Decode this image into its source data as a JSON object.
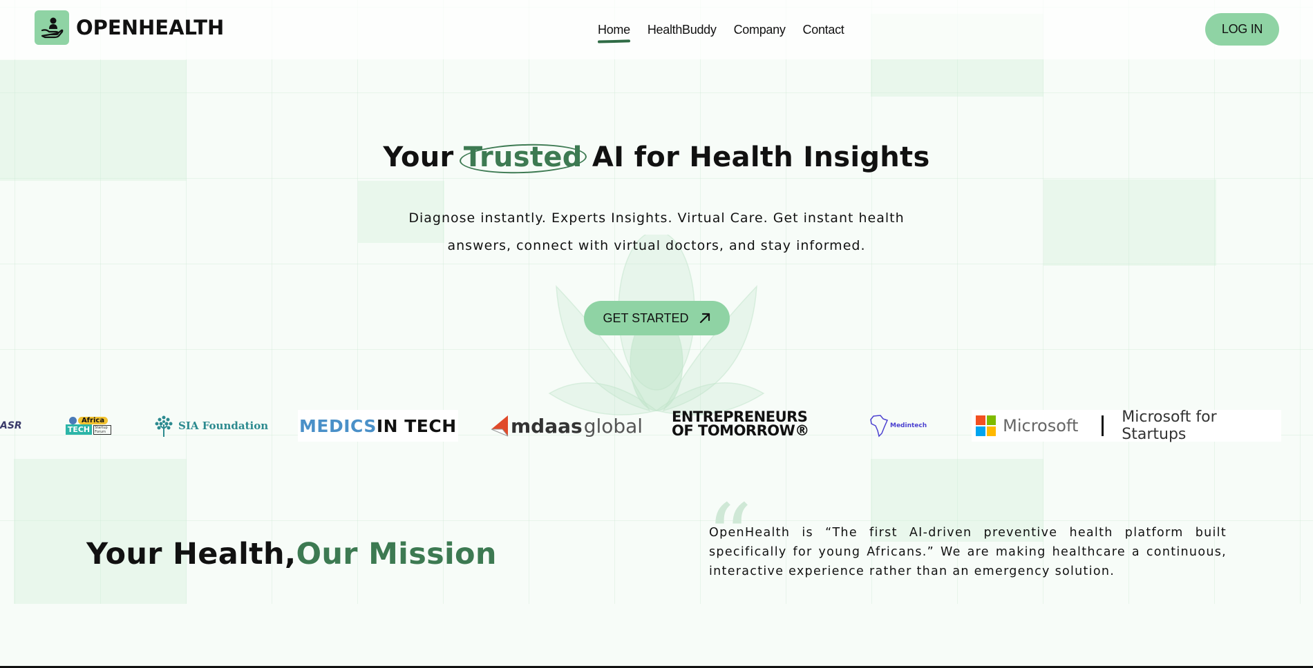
{
  "brand": {
    "name": "OPENHEALTH",
    "logo_icon": "hand-holding-person-icon"
  },
  "nav": {
    "items": [
      {
        "label": "Home",
        "active": true
      },
      {
        "label": "HealthBuddy"
      },
      {
        "label": "Company"
      },
      {
        "label": "Contact"
      }
    ],
    "login_label": "LOG IN"
  },
  "hero": {
    "title_before": "Your ",
    "title_highlight": "Trusted",
    "title_after": " AI for Health Insights",
    "subtitle_line1": "Diagnose instantly. Experts Insights. Virtual Care. Get instant health",
    "subtitle_line2": "answers, connect with virtual doctors, and stay informed.",
    "cta_label": "GET STARTED",
    "cta_icon": "arrow-up-right-icon"
  },
  "partners": {
    "asr": "ASR",
    "africa_tech_top": "Africa",
    "africa_tech_bottom": "TECH",
    "africa_tech_side": "Startup Forum",
    "sia": "SIA Foundation",
    "medics_1": "MEDICS",
    "medics_2": " IN TECH",
    "mdaas_1": "mdaas",
    "mdaas_2": "global",
    "eot_1": "ENTREPRENEURS",
    "eot_2": "OF TOMORROW®",
    "medintech": "Medintech",
    "microsoft": "Microsoft",
    "ms_startups": "Microsoft for Startups"
  },
  "mission": {
    "title_main": "Your Health,",
    "title_accent": "Our Mission",
    "text": "OpenHealth is “The first AI-driven preventive health platform built specifically for young Africans.” We are making healthcare a continuous, interactive experience rather than an emergency solution."
  },
  "colors": {
    "accent_green": "#8fd3a4",
    "dark_green": "#3d7a52",
    "background": "#f7fcf8"
  }
}
